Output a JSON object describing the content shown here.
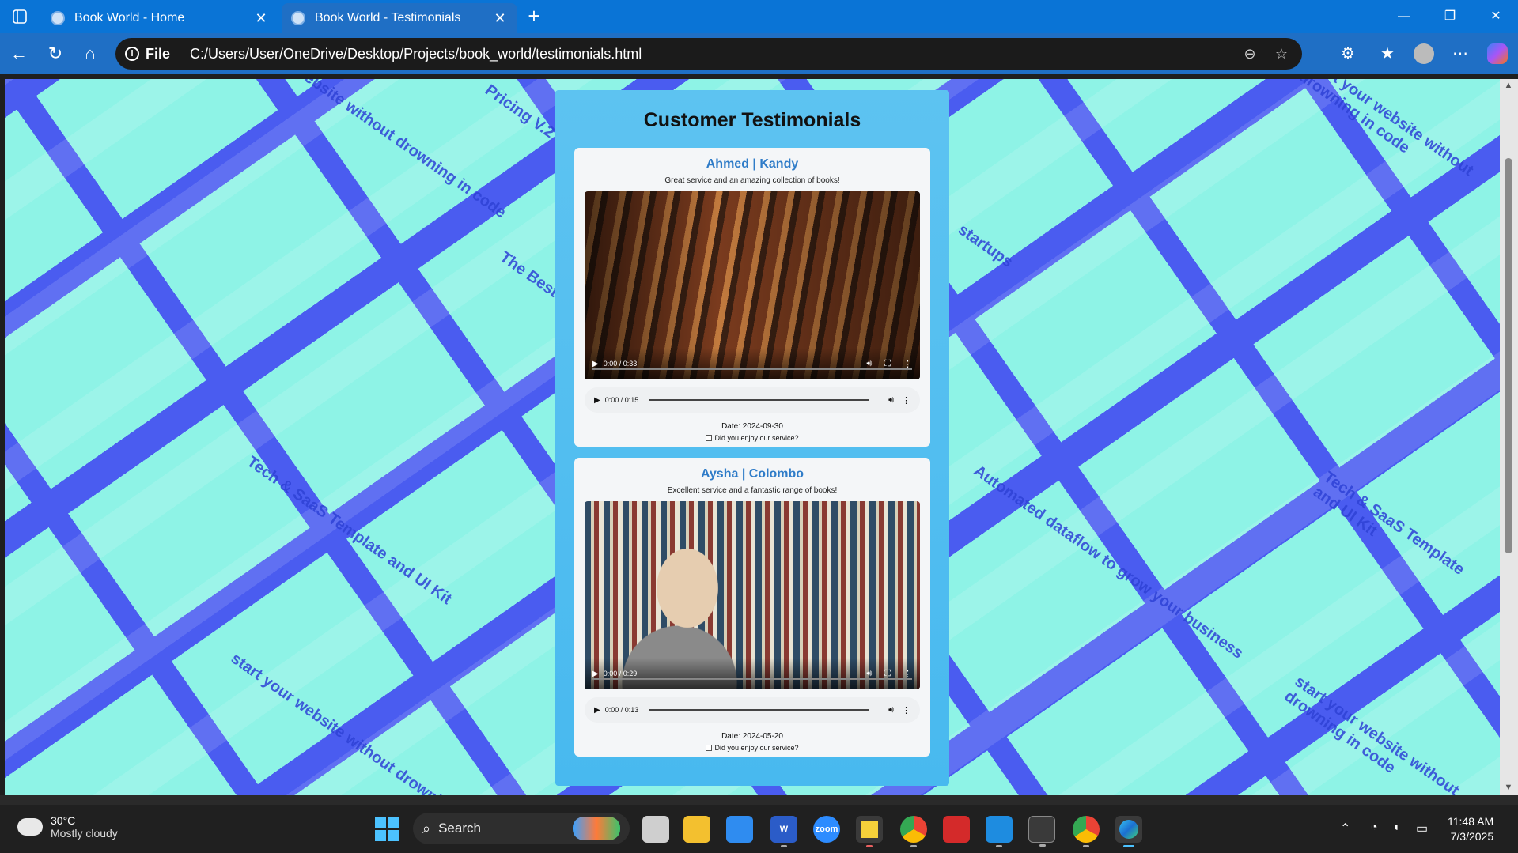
{
  "browser": {
    "tabs": [
      {
        "label": "Book World - Home"
      },
      {
        "label": "Book World - Testimonials"
      }
    ],
    "address": {
      "scheme_label": "File",
      "url": "C:/Users/User/OneDrive/Desktop/Projects/book_world/testimonials.html"
    }
  },
  "page": {
    "heading": "Customer Testimonials",
    "background_words": [
      "start your website without drowning in code",
      "The Best Customer Experiences",
      "Tech & SaaS Template and UI Kit",
      "startups",
      "Automated dataflow to grow your business",
      "Pricing V.2"
    ],
    "testimonials": [
      {
        "name": "Ahmed | Kandy",
        "message": "Great service and an amazing collection of books!",
        "video_time": "0:00 / 0:33",
        "audio_time": "0:00 / 0:15",
        "date": "Date: 2024-09-30",
        "question": "Did you enjoy our service?"
      },
      {
        "name": "Aysha | Colombo",
        "message": "Excellent service and a fantastic range of books!",
        "video_time": "0:00 / 0:29",
        "audio_time": "0:00 / 0:13",
        "date": "Date: 2024-05-20",
        "question": "Did you enjoy our service?"
      }
    ]
  },
  "taskbar": {
    "weather": {
      "temp": "30°C",
      "condition": "Mostly cloudy"
    },
    "search_label": "Search",
    "time": "11:48 AM",
    "date": "7/3/2025",
    "apps": [
      "task-view",
      "file-explorer",
      "notepad",
      "word",
      "zoom",
      "sticky-notes",
      "chrome",
      "acrobat",
      "vscode",
      "terminal",
      "chrome",
      "edge"
    ]
  },
  "colors": {
    "titlebar": "#0a74d6",
    "panel": "#5dc3f1",
    "name_accent": "#2f7cc8",
    "bg_teal": "#8ef3e6",
    "bg_blue": "#4a5cf0"
  }
}
